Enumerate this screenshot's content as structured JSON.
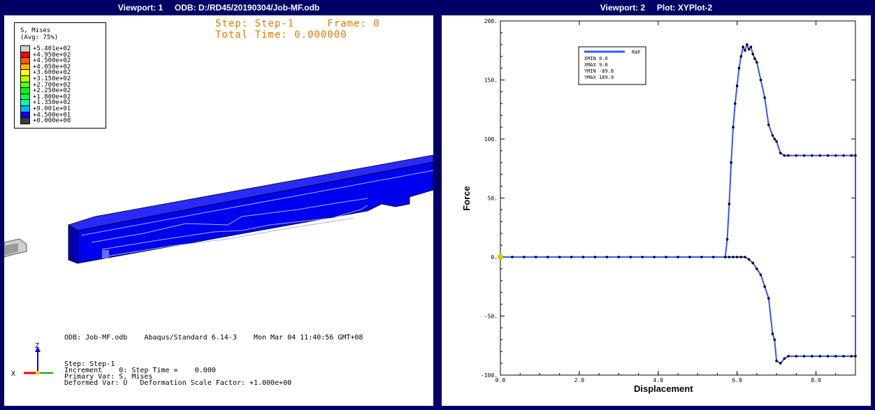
{
  "viewport1": {
    "title": "Viewport: 1     ODB: D:/RD45/20190304/Job-MF.odb",
    "legend": {
      "title": "S, Mises",
      "subtitle": "(Avg: 75%)",
      "entries": [
        {
          "label": "+5.401e+02",
          "color": "#d0d0d0"
        },
        {
          "label": "+4.950e+02",
          "color": "#ff0000"
        },
        {
          "label": "+4.500e+02",
          "color": "#ff5a00"
        },
        {
          "label": "+4.050e+02",
          "color": "#ffb400"
        },
        {
          "label": "+3.600e+02",
          "color": "#ffff00"
        },
        {
          "label": "+3.150e+02",
          "color": "#b4ff00"
        },
        {
          "label": "+2.700e+02",
          "color": "#5aff00"
        },
        {
          "label": "+2.250e+02",
          "color": "#00ff00"
        },
        {
          "label": "+1.800e+02",
          "color": "#00ff5a"
        },
        {
          "label": "+1.350e+02",
          "color": "#00ffb4"
        },
        {
          "label": "+9.001e+01",
          "color": "#00b4ff"
        },
        {
          "label": "+4.500e+01",
          "color": "#0000ff"
        },
        {
          "label": "+0.000e+00",
          "color": "#3a3a3a"
        }
      ]
    },
    "step_line": "Step: Step-1     Frame: 0",
    "time_line": "Total Time: 0.000000",
    "odb_line": "ODB: Job-MF.odb    Abaqus/Standard 6.14-3    Mon Mar 04 11:40:56 GMT+08",
    "info_lines": [
      "Step: Step-1",
      "Increment    0: Step Time =    0.000",
      "Primary Var: S, Mises",
      "Deformed Var: U   Deformation Scale Factor: +1.000e+00"
    ],
    "triad": {
      "z": "Z",
      "x": "X"
    }
  },
  "viewport2": {
    "title": "Viewport: 2     Plot: XYPlot-2",
    "colors": {
      "line": "#3355ff",
      "marker": "#000000",
      "start": "#e0c000"
    },
    "legend": {
      "series_label": "RAF",
      "rows": [
        "XMIN  0.0",
        "XMAX  9.0",
        "YMIN  -89.8",
        "YMAX  189.9"
      ]
    }
  },
  "chart_data": {
    "type": "line",
    "title": "",
    "xlabel": "Displacement",
    "ylabel": "Force",
    "xlim": [
      0,
      9
    ],
    "ylim": [
      -100,
      200
    ],
    "xticks": [
      0,
      2,
      4,
      6,
      8
    ],
    "xtick_labels": [
      "0.0",
      "2.0",
      "4.0",
      "6.0",
      "8.0"
    ],
    "yticks": [
      -100,
      -50,
      0,
      50,
      100,
      150,
      200
    ],
    "ytick_labels": [
      "-100.",
      "-50.",
      "0.",
      "50.",
      "100.",
      "150.",
      "200."
    ],
    "grid": false,
    "legend_position": "top-left",
    "series": [
      {
        "name": "RAF",
        "x": [
          0,
          0.3,
          0.6,
          0.9,
          1.2,
          1.5,
          1.8,
          2.1,
          2.4,
          2.7,
          3.0,
          3.3,
          3.6,
          3.9,
          4.2,
          4.5,
          4.8,
          5.1,
          5.4,
          5.7,
          5.75,
          5.8,
          5.85,
          5.9,
          5.95,
          6.0,
          6.05,
          6.1,
          6.15,
          6.2,
          6.25,
          6.3,
          6.35,
          6.4,
          6.45,
          6.5,
          6.6,
          6.7,
          6.8,
          6.9,
          6.95,
          7.0,
          7.1,
          7.2,
          7.3,
          7.5,
          7.7,
          7.9,
          8.1,
          8.3,
          8.5,
          8.7,
          8.9,
          9.0,
          9.0,
          8.9,
          8.7,
          8.5,
          8.3,
          8.1,
          7.9,
          7.7,
          7.5,
          7.3,
          7.2,
          7.1,
          7.0,
          6.95,
          6.9,
          6.8,
          6.7,
          6.6,
          6.5,
          6.4,
          6.3,
          6.2,
          6.1,
          6.0,
          5.9,
          5.8,
          0
        ],
        "y": [
          0,
          0,
          0,
          0,
          0,
          0,
          0,
          0,
          0,
          0,
          0,
          0,
          0,
          0,
          0,
          0,
          0,
          0,
          0,
          0,
          15,
          45,
          80,
          110,
          130,
          145,
          160,
          170,
          178,
          175,
          180,
          176,
          178,
          172,
          168,
          165,
          150,
          135,
          112,
          103,
          100,
          98,
          88,
          86,
          86,
          86,
          86,
          86,
          86,
          86,
          86,
          86,
          86,
          86,
          -84,
          -84,
          -84,
          -84,
          -84,
          -84,
          -84,
          -84,
          -84,
          -84,
          -86,
          -90,
          -88,
          -70,
          -65,
          -35,
          -25,
          -15,
          -10,
          -5,
          -2,
          0,
          0,
          0,
          0,
          0,
          0
        ]
      }
    ]
  }
}
